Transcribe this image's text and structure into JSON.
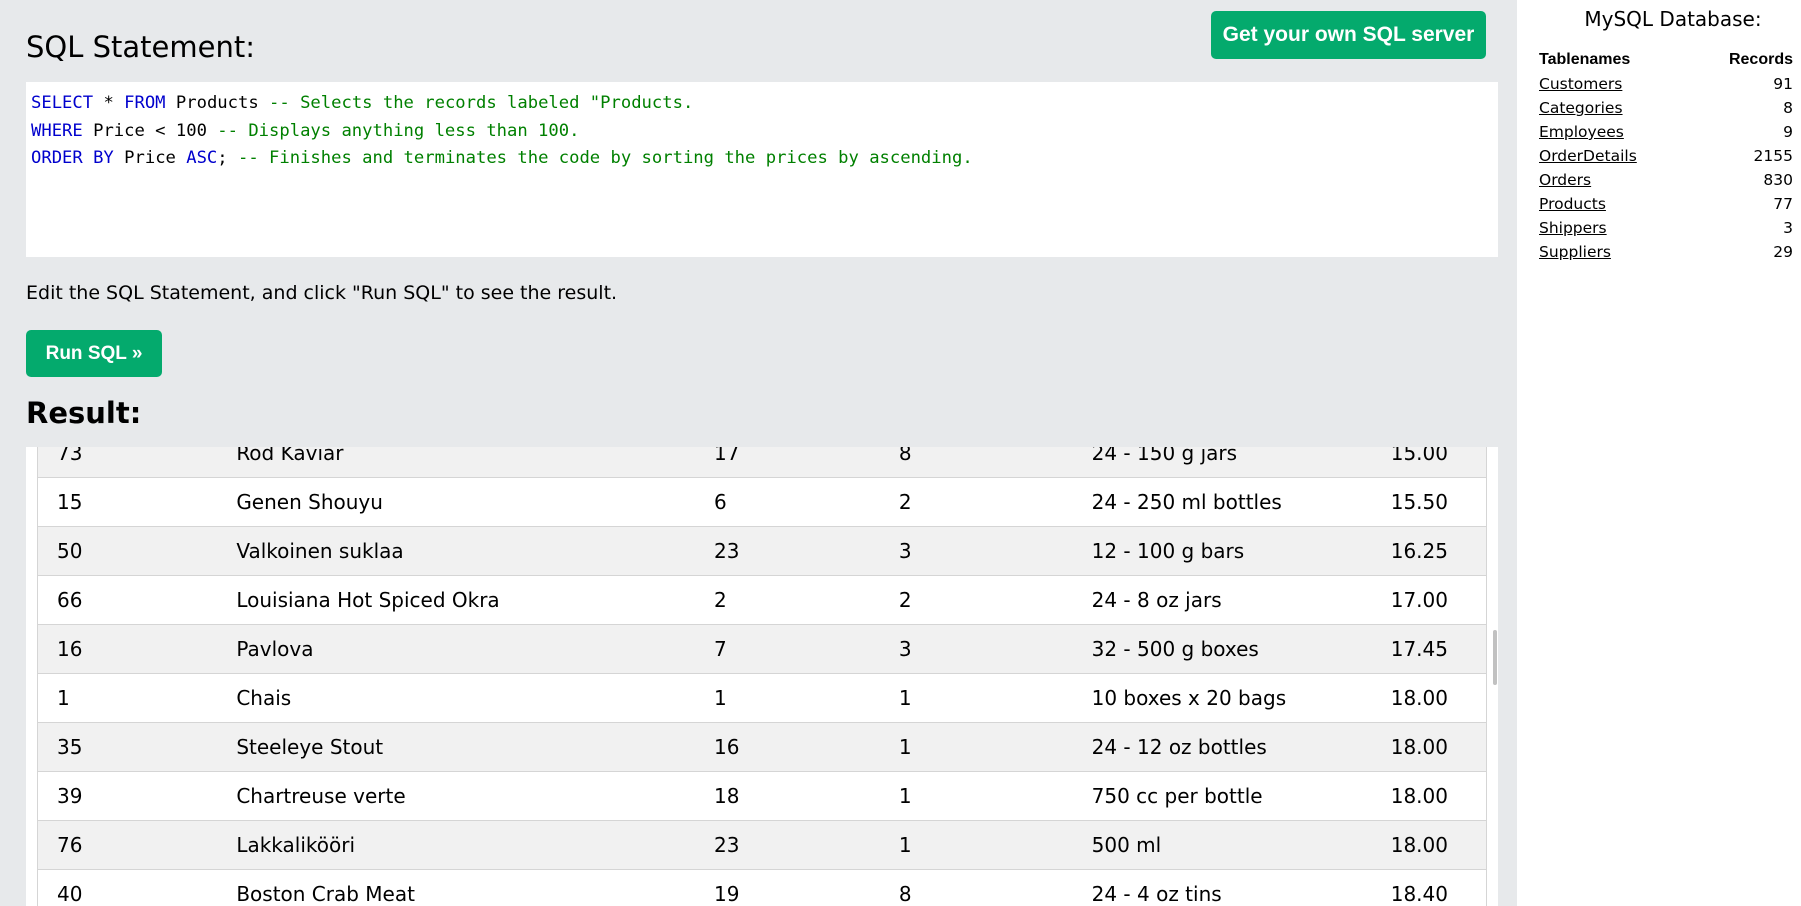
{
  "header": {
    "statement_title": "SQL Statement:",
    "get_server_label": "Get your own SQL server"
  },
  "editor": {
    "lines": [
      [
        {
          "type": "kw",
          "text": "SELECT"
        },
        {
          "type": "id",
          "text": " * "
        },
        {
          "type": "kw",
          "text": "FROM"
        },
        {
          "type": "id",
          "text": " Products "
        },
        {
          "type": "cm",
          "text": "-- Selects the records labeled \"Products."
        }
      ],
      [
        {
          "type": "kw",
          "text": "WHERE"
        },
        {
          "type": "id",
          "text": " Price < 100 "
        },
        {
          "type": "cm",
          "text": "-- Displays anything less than 100."
        }
      ],
      [
        {
          "type": "kw",
          "text": "ORDER BY"
        },
        {
          "type": "id",
          "text": " Price "
        },
        {
          "type": "kw",
          "text": "ASC"
        },
        {
          "type": "id",
          "text": "; "
        },
        {
          "type": "cm",
          "text": "-- Finishes and terminates the code by sorting the prices by ascending."
        }
      ]
    ]
  },
  "instructions": "Edit the SQL Statement, and click \"Run SQL\" to see the result.",
  "run_button_label": "Run SQL »",
  "result": {
    "title": "Result:",
    "rows": [
      [
        "73",
        "Röd Kaviar",
        "17",
        "8",
        "24 - 150 g jars",
        "15.00"
      ],
      [
        "15",
        "Genen Shouyu",
        "6",
        "2",
        "24 - 250 ml bottles",
        "15.50"
      ],
      [
        "50",
        "Valkoinen suklaa",
        "23",
        "3",
        "12 - 100 g bars",
        "16.25"
      ],
      [
        "66",
        "Louisiana Hot Spiced Okra",
        "2",
        "2",
        "24 - 8 oz jars",
        "17.00"
      ],
      [
        "16",
        "Pavlova",
        "7",
        "3",
        "32 - 500 g boxes",
        "17.45"
      ],
      [
        "1",
        "Chais",
        "1",
        "1",
        "10 boxes x 20 bags",
        "18.00"
      ],
      [
        "35",
        "Steeleye Stout",
        "16",
        "1",
        "24 - 12 oz bottles",
        "18.00"
      ],
      [
        "39",
        "Chartreuse verte",
        "18",
        "1",
        "750 cc per bottle",
        "18.00"
      ],
      [
        "76",
        "Lakkalikööri",
        "23",
        "1",
        "500 ml",
        "18.00"
      ],
      [
        "40",
        "Boston Crab Meat",
        "19",
        "8",
        "24 - 4 oz tins",
        "18.40"
      ]
    ]
  },
  "database": {
    "title": "MySQL Database:",
    "col_tablenames": "Tablenames",
    "col_records": "Records",
    "tables": [
      {
        "name": "Customers",
        "count": "91"
      },
      {
        "name": "Categories",
        "count": "8"
      },
      {
        "name": "Employees",
        "count": "9"
      },
      {
        "name": "OrderDetails",
        "count": "2155"
      },
      {
        "name": "Orders",
        "count": "830"
      },
      {
        "name": "Products",
        "count": "77"
      },
      {
        "name": "Shippers",
        "count": "3"
      },
      {
        "name": "Suppliers",
        "count": "29"
      }
    ]
  },
  "colors": {
    "accent_green": "#04aa6d",
    "panel_bg": "#e7e9eb",
    "keyword": "#0000cd",
    "comment": "#008000"
  }
}
